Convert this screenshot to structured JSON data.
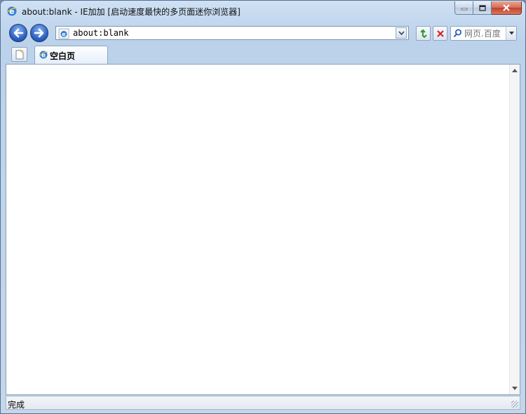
{
  "window": {
    "title": "about:blank - IE加加 [启动速度最快的多页面迷你浏览器]"
  },
  "nav": {
    "back_icon": "back-arrow-icon",
    "forward_icon": "forward-arrow-icon"
  },
  "address": {
    "value": "about:blank"
  },
  "search": {
    "placeholder": "网页.百度"
  },
  "tabs": [
    {
      "label": "空白页",
      "active": true
    }
  ],
  "status": {
    "text": "完成"
  },
  "colors": {
    "frame": "#c3d8ef",
    "close_button": "#c3412a",
    "nav_button": "#2e63c4",
    "refresh_arrow": "#2d9a2d",
    "stop_x": "#d22a1f"
  }
}
